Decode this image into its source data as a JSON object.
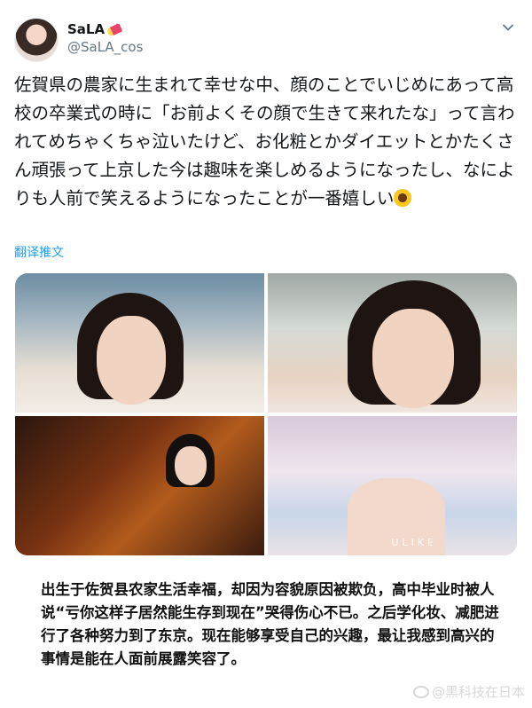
{
  "tweet": {
    "author": {
      "display_name": "SaLA",
      "handle": "@SaLA_cos",
      "name_emoji": "lipstick-emoji"
    },
    "text": "佐賀県の農家に生まれて幸せな中、顔のことでいじめにあって高校の卒業式の時に「お前よくその顔で生きて来れたな」って言われてめちゃくちゃ泣いたけど、お化粧とかダイエットとかたくさん頑張って上京した今は趣味を楽しめるようになったし、なによりも人前で笑えるようになったことが一番嬉しい",
    "trailing_emoji": "sunflower-emoji",
    "translate_label": "翻译推文",
    "media": {
      "count": 4,
      "watermark": "ULIKE"
    }
  },
  "caption": "出生于佐贺县农家生活幸福，却因为容貌原因被欺负，高中毕业时被人说“亏你这样子居然能生存到现在”哭得伤心不已。之后学化妆、减肥进行了各种努力到了东京。现在能够享受自己的兴趣，最让我感到高兴的事情是能在人面前展露笑容了。",
  "source_watermark": "@黑科技在日本",
  "colors": {
    "link": "#1da1f2",
    "secondary_text": "#657786",
    "primary_text": "#14171a"
  }
}
